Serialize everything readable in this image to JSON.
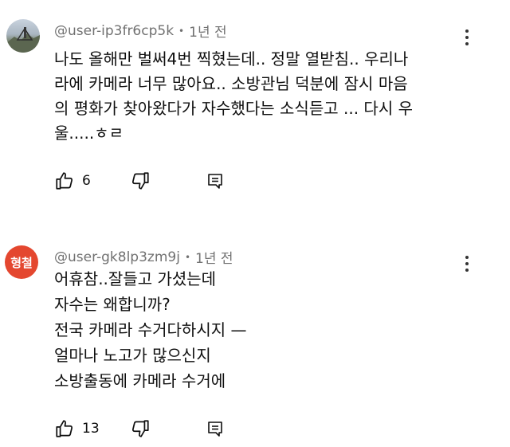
{
  "comments": [
    {
      "author": "@user-ip3fr6cp5k",
      "separator": "•",
      "time": "1년 전",
      "avatar": {
        "type": "photo",
        "text": ""
      },
      "lines": [
        "나도 올해만 벌써4번 찍혔는데.. 정말 열받침..  우리나",
        "라에 카메라 너무 많아요..   소방관님 덕분에 잠시 마음",
        "의 평화가 찾아왔다가  자수했다는 소식듣고 ... 다시 우",
        "울.....ㅎㄹ"
      ],
      "likes": "6"
    },
    {
      "author": "@user-gk8lp3zm9j",
      "separator": "•",
      "time": "1년 전",
      "avatar": {
        "type": "text",
        "text": "형철",
        "color": "#e4472f"
      },
      "lines": [
        "어휴참..잘들고 가셨는데",
        "자수는 왜합니까?",
        "전국 카메라 수거다하시지 —",
        "얼마나 노고가 많으신지",
        "소방출동에 카메라 수거에"
      ],
      "likes": "13"
    }
  ],
  "icons": {
    "like": "thumbs-up-icon",
    "dislike": "thumbs-down-icon",
    "reply": "reply-comment-icon",
    "more": "more-vertical-icon"
  }
}
